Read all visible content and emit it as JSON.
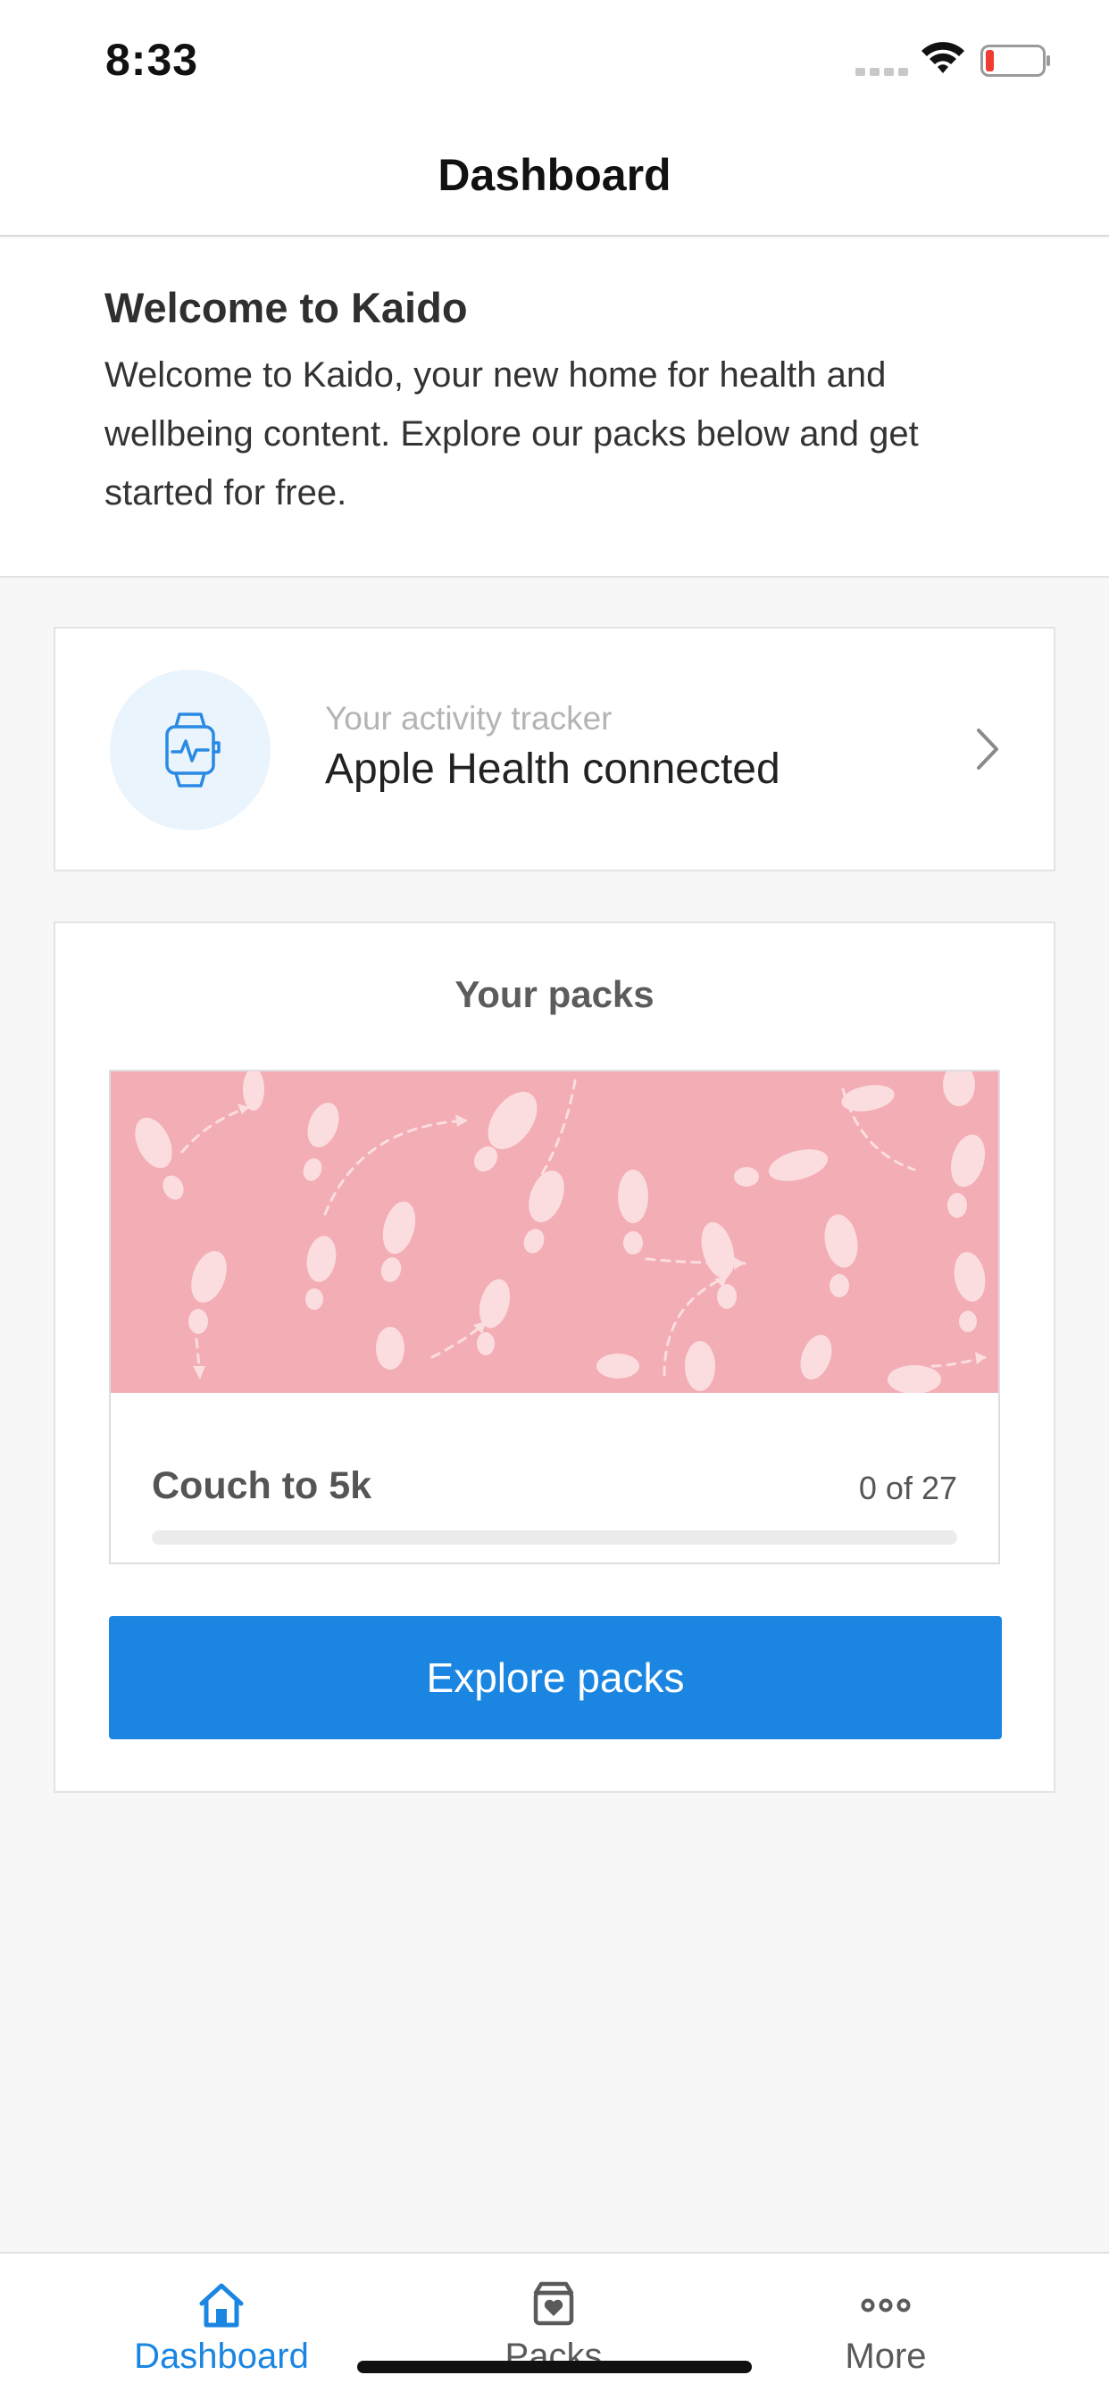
{
  "status_bar": {
    "time": "8:33",
    "battery_icon": "battery-low-icon",
    "wifi_icon": "wifi-icon",
    "signal_icon": "signal-icon"
  },
  "nav": {
    "title": "Dashboard"
  },
  "welcome": {
    "title": "Welcome to Kaido",
    "body": "Welcome to Kaido, your new home for health and wellbeing content. Explore our packs below and get started for free."
  },
  "tracker": {
    "subtitle": "Your activity tracker",
    "title": "Apple Health connected",
    "icon": "smartwatch-icon"
  },
  "packs": {
    "title": "Your packs",
    "items": [
      {
        "name": "Couch to 5k",
        "progress_text": "0 of 27",
        "progress": 0
      }
    ],
    "explore_label": "Explore packs"
  },
  "tabs": [
    {
      "label": "Dashboard",
      "icon": "home-icon",
      "active": true
    },
    {
      "label": "Packs",
      "icon": "box-heart-icon",
      "active": false
    },
    {
      "label": "More",
      "icon": "more-dots-icon",
      "active": false
    }
  ],
  "colors": {
    "accent": "#1a86e2",
    "banner": "#f3adb4",
    "inactive_tab": "#5a5a5a"
  }
}
